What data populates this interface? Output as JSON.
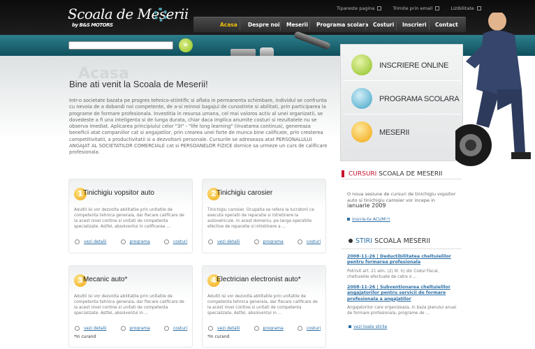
{
  "logo": {
    "title": "Scoala de Meserii",
    "subtitle": "by B&S MOTORS"
  },
  "toplinks": {
    "print": "Tipareste pagina",
    "email": "Trimite prin email",
    "mobile": "Lizibilitate"
  },
  "nav": [
    "Acasa",
    "Despre noi",
    "Meserii",
    "Programa scolara",
    "Costuri",
    "Inscrieri",
    "Contact"
  ],
  "search": {
    "button": "»"
  },
  "main": {
    "ghost": "Acasa",
    "title": "Bine ati venit la Scoala de Meserii!",
    "intro": "Intr-o societate bazata pe progres tehnico-stiintific si aflata in permanenta schimbare, individul se confrunta cu nevoia de a dobandi noi competente, de a-si reinnoi bagajul de cunostinte si abilitati, prin participarea la programe de formare profesionala. Investitia in resursa umana, cel mai valoros activ al unei organizatii, se dovedeste a fi una inteligenta si de lunga durata, chiar daca implica anumite costuri si rezultatele nu se observa imediat. Aplicarea principiului celor \"3I\" - \"life long learning\" (invatarea continua), genereaza beneficii atat companiilor cat si angajatilor, prin crearea unei forte de munca bine calificate, prin cresterea competitivitatii, a productivitatii si a dezvoltarii personale. Cursurile se adreseaza atat PERSONALULUI ANGAJAT AL SOCIETATILOR COMERCIALE cat si PERSOANELOR FIZICE dornice sa urmeze un curs de calificare profesionala."
  },
  "cards": [
    {
      "num": "1",
      "title": "Tinichigiu vopsitor auto",
      "text": "Adultii isi vor dezvolta abilitatile prin unitatile de competenta tehnica generala, dar fiecare calificare de la acest nivel contine si unitati de competenta specializate. Astfel, absolventul in calificarea ...",
      "l1": "vezi detalii",
      "l2": "programa",
      "l3": "costuri",
      "note": ""
    },
    {
      "num": "2",
      "title": "Tinichigiu carosier",
      "text": "Tinichigiu carosier. Ocupatia se refera la lucratorii ce executa operatii de reparatie si intretinere la autovehicule. In acest domeniu, pe langa operatiile efective de reparatie si intretinere a ...",
      "l1": "vezi detalii",
      "l2": "programa",
      "l3": "costuri",
      "note": ""
    },
    {
      "num": "3",
      "title": "Mecanic auto*",
      "text": "Adultii isi vor dezvolta abilitatile prin unitatile de competenta tehnica generala, dar fiecare calificare de la acest nivel contine si unitati de competenta specializate. Astfel, absolventul in ...",
      "l1": "vezi detalii",
      "l2": "programa",
      "l3": "costuri",
      "note": "*In curand"
    },
    {
      "num": "4",
      "title": "Electrician electronist auto*",
      "text": "Adultii isi vor dezvolta abilitatile prin unitatile de competenta tehnica generala, dar fiecare calificare de la acest nivel contine si unitati de competenta specializate. Astfel, absolventul in ...",
      "l1": "vezi detalii",
      "l2": "programa",
      "l3": "costuri",
      "note": "*In curand"
    }
  ],
  "quick": [
    "INSCRIERE ONLINE",
    "PROGRAMA SCOLARA",
    "MESERII"
  ],
  "cursuri": {
    "title": "CURSURI",
    "title2": "SCOALA DE MESERII",
    "text": "O noua sesiune de cursuri de tinichigiu vopsitor auto si tinichigiu carosier vor incepe in",
    "date": "ianuarie 2009",
    "link": "inscrie-te ACUM!!!"
  },
  "stiri": {
    "title": "STIRI",
    "title2": "SCOALA MESERII",
    "items": [
      {
        "title": "2008-11-26 | Deductibilitatea cheltuielilor pentru formarea profesionala",
        "text": "Potrivit art. 21 alin. (2) lit. h) din Codul Fiscal, cheltuielile efectuate de catre o ..."
      },
      {
        "title": "2008-11-26 | Subventionarea cheltuielilor angajatorilor pentru servicii de formare profesionala a angajatilor",
        "text": "Angajatorilor care organizeaza, in baza planului anual de formare profesionala, programe de ..."
      }
    ],
    "all": "vezi toate stirile"
  },
  "colors": {
    "accent": "#f2c10a",
    "teal": "#2e7f8d",
    "red": "#c8102e",
    "link": "#2a6ea5"
  }
}
